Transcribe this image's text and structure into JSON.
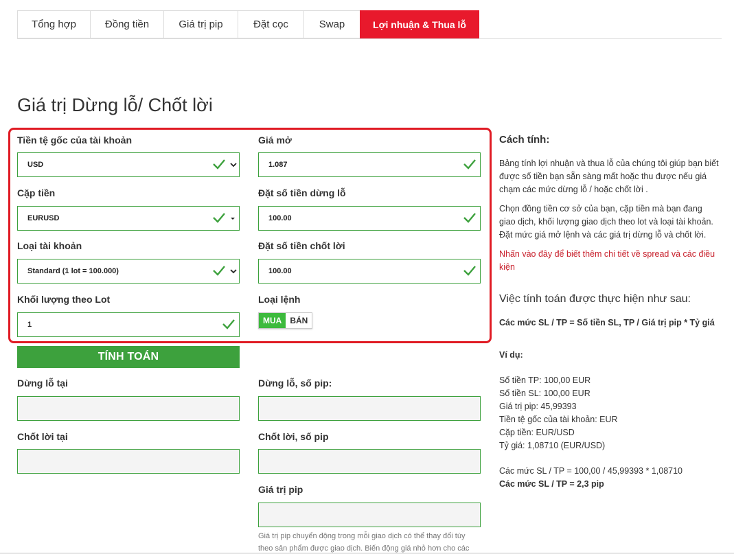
{
  "tabs": [
    {
      "label": "Tổng hợp",
      "active": false
    },
    {
      "label": "Đồng tiền",
      "active": false
    },
    {
      "label": "Giá trị pip",
      "active": false
    },
    {
      "label": "Đặt cọc",
      "active": false
    },
    {
      "label": "Swap",
      "active": false
    },
    {
      "label": "Lợi nhuận & Thua lỗ",
      "active": true
    }
  ],
  "page_title": "Giá trị Dừng lỗ/ Chốt lời",
  "form": {
    "base_currency": {
      "label": "Tiền tệ gốc của tài khoản",
      "value": "USD"
    },
    "open_price": {
      "label": "Giá mở",
      "value": "1.087"
    },
    "currency_pair": {
      "label": "Cặp tiền",
      "value": "EURUSD"
    },
    "stop_loss_amount": {
      "label": "Đặt số tiền dừng lỗ",
      "value": "100.00"
    },
    "account_type": {
      "label": "Loại tài khoản",
      "value": "Standard (1 lot = 100.000)"
    },
    "take_profit_amount": {
      "label": "Đặt số tiền chốt lời",
      "value": "100.00"
    },
    "lot_volume": {
      "label": "Khối lượng theo Lot",
      "value": "1"
    },
    "order_type": {
      "label": "Loại lệnh",
      "buy": "MUA",
      "sell": "BÁN",
      "selected": "MUA"
    }
  },
  "calculate_button": "TÍNH TOÁN",
  "results": {
    "stop_loss_at": "Dừng lỗ tại",
    "stop_loss_pips": "Dừng lỗ, số pip:",
    "take_profit_at": "Chốt lời tại",
    "take_profit_pips": "Chốt lời, số pip",
    "pip_value": "Giá trị pip"
  },
  "pip_note_line1": "Giá trị pip chuyển động trong mỗi giao dịch có thể thay đổi tùy",
  "pip_note_line2": "theo sản phẩm được giao dịch. Biến động giá nhỏ hơn cho các",
  "side": {
    "how_title": "Cách tính:",
    "para1": "Bảng tính lợi nhuận và thua lỗ của chúng tôi giúp bạn biết được số tiền bạn sẵn sàng mất hoặc thu được nếu giá chạm các mức dừng lỗ / hoặc chốt lời .",
    "para2": "Chọn đồng tiền cơ sở của bạn, cặp tiền mà bạn đang giao dịch, khối lượng giao dịch theo lot và loại tài khoản. Đặt mức giá mở lệnh và các giá trị dừng lỗ và chốt lời.",
    "link": "Nhấn vào đây để biết thêm chi tiết về spread và các điều kiện",
    "calc_title": "Việc tính toán được thực hiện như sau:",
    "formula": "Các mức SL / TP = Số tiền SL, TP / Giá trị pip * Tỷ giá",
    "example_title": "Ví dụ:",
    "example_lines": [
      "Số tiền TP: 100,00 EUR",
      "Số tiền SL: 100,00 EUR",
      "Giá trị pip: 45,99393",
      "Tiền tệ gốc của tài khoản: EUR",
      "Cặp tiền: EUR/USD",
      "Tỷ giá: 1,08710 (EUR/USD)"
    ],
    "result_line1": "Các mức SL / TP = 100,00 / 45,99393 * 1,08710",
    "result_line2": "Các mức SL / TP = 2,3 pip"
  },
  "colors": {
    "accent_red": "#e8192c",
    "green": "#3da13d",
    "toggle_green": "#3dba3d"
  }
}
